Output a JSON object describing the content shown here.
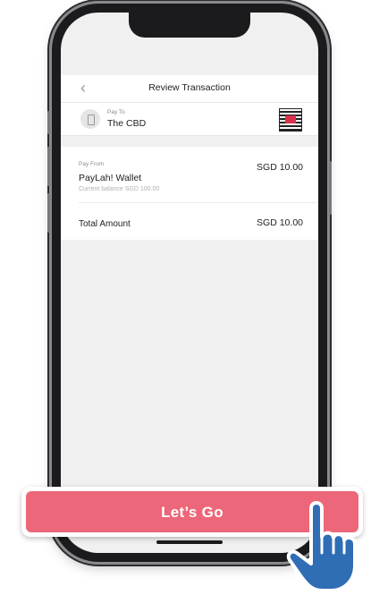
{
  "screen": {
    "nav": {
      "back_icon": "chevron-left-icon",
      "title": "Review Transaction"
    },
    "pay_to": {
      "label": "Pay To",
      "merchant": "The CBD",
      "merchant_icon": "store-icon",
      "qr_icon": "qr-code-icon"
    },
    "pay_from": {
      "label": "Pay From",
      "source": "PayLah! Wallet",
      "balance": "Current balance SGD 100.00",
      "amount": "SGD 10.00"
    },
    "total": {
      "label": "Total Amount",
      "amount": "SGD 10.00"
    }
  },
  "cta": {
    "label": "Let’s Go",
    "color": "#ec6779"
  },
  "pointer": {
    "icon": "hand-pointer-icon",
    "color": "#2f6db5"
  }
}
